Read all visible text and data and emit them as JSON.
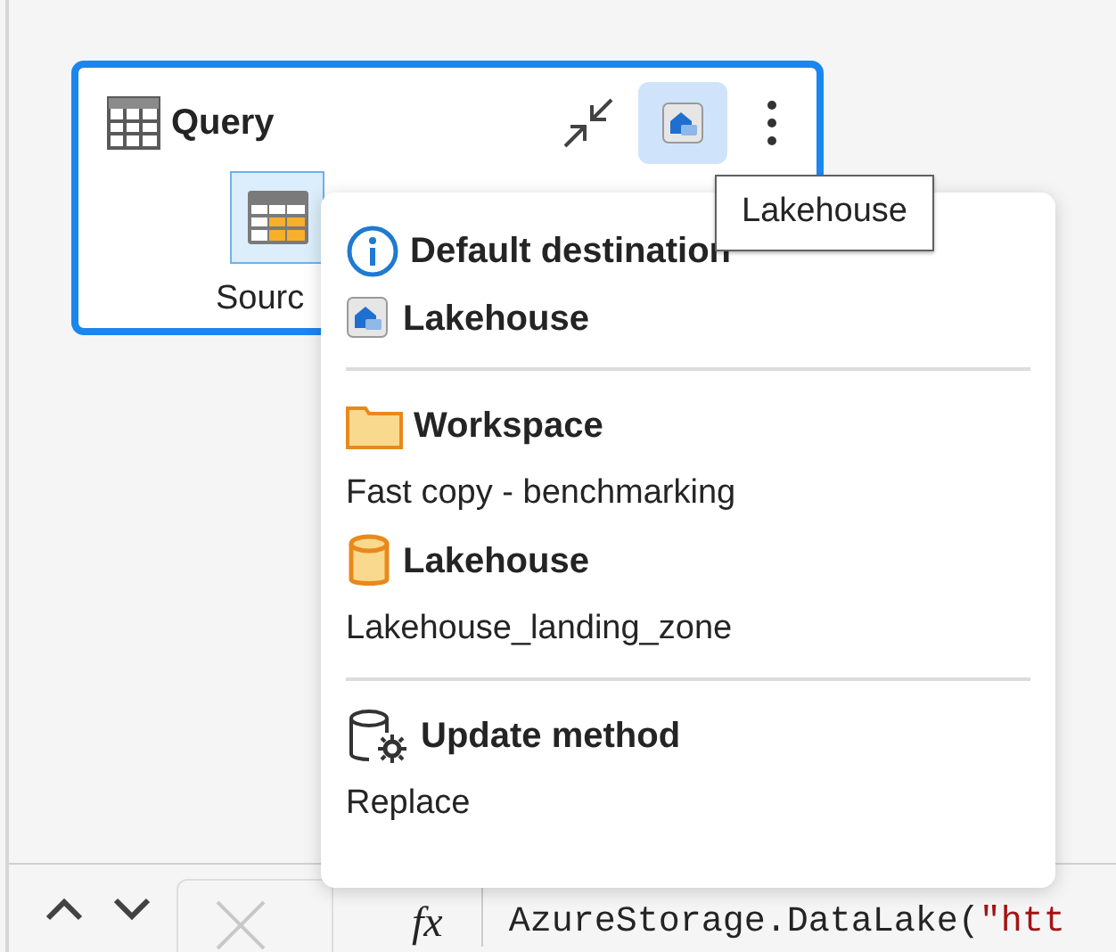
{
  "query_card": {
    "title": "Query",
    "selected": true,
    "step": {
      "label": "Sourc",
      "selected": true
    },
    "destination_button": {
      "selected": true
    }
  },
  "tooltip": "Lakehouse",
  "popup": {
    "sections": [
      {
        "rows": [
          {
            "kind": "info",
            "text": "Default destination"
          },
          {
            "kind": "lakehouse",
            "text": "Lakehouse"
          }
        ]
      },
      {
        "rows": [
          {
            "kind": "folder",
            "text": "Workspace"
          },
          {
            "kind": "value",
            "text": "Fast copy - benchmarking"
          },
          {
            "kind": "database",
            "text": "Lakehouse"
          },
          {
            "kind": "value",
            "text": "Lakehouse_landing_zone"
          }
        ]
      },
      {
        "rows": [
          {
            "kind": "database-gear",
            "text": "Update method"
          },
          {
            "kind": "value",
            "text": "Replace"
          }
        ]
      }
    ]
  },
  "formula_bar": {
    "fx_label": "fx",
    "code": "AzureStorage.DataLake(",
    "string": "\"htt"
  }
}
